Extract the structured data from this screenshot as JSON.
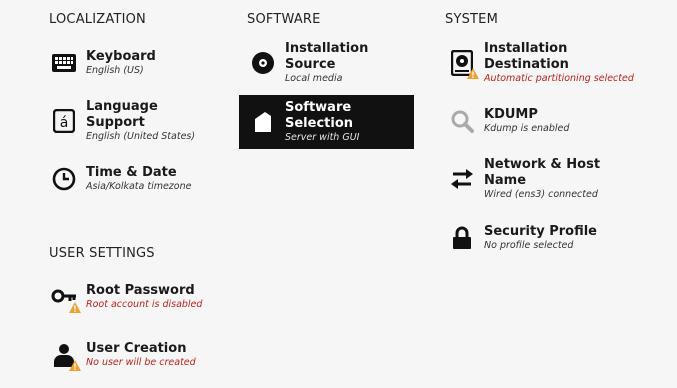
{
  "sections": {
    "localization": "LOCALIZATION",
    "software": "SOFTWARE",
    "system": "SYSTEM",
    "user_settings": "USER SETTINGS"
  },
  "spokes": {
    "keyboard": {
      "title": "Keyboard",
      "status": "English (US)",
      "icon": "keyboard-icon"
    },
    "language": {
      "title": "Language Support",
      "status": "English (United States)",
      "icon": "language-icon"
    },
    "time": {
      "title": "Time & Date",
      "status": "Asia/Kolkata timezone",
      "icon": "clock-icon"
    },
    "install_source": {
      "title": "Installation Source",
      "status": "Local media",
      "icon": "disc-icon"
    },
    "software_selection": {
      "title": "Software Selection",
      "status": "Server with GUI",
      "icon": "package-icon"
    },
    "install_dest": {
      "title": "Installation Destination",
      "status": "Automatic partitioning selected",
      "icon": "harddisk-icon"
    },
    "kdump": {
      "title": "KDUMP",
      "status": "Kdump is enabled",
      "icon": "search-icon"
    },
    "network": {
      "title": "Network & Host Name",
      "status": "Wired (ens3) connected",
      "icon": "network-arrows-icon"
    },
    "security": {
      "title": "Security Profile",
      "status": "No profile selected",
      "icon": "lock-icon"
    },
    "root_password": {
      "title": "Root Password",
      "status": "Root account is disabled",
      "icon": "key-icon"
    },
    "user_creation": {
      "title": "User Creation",
      "status": "No user will be created",
      "icon": "user-icon"
    }
  },
  "colors": {
    "background": "#f6f6f6",
    "selected_bg": "#111111",
    "warning_text": "#c0221d",
    "warning_badge": "#f0a030"
  }
}
